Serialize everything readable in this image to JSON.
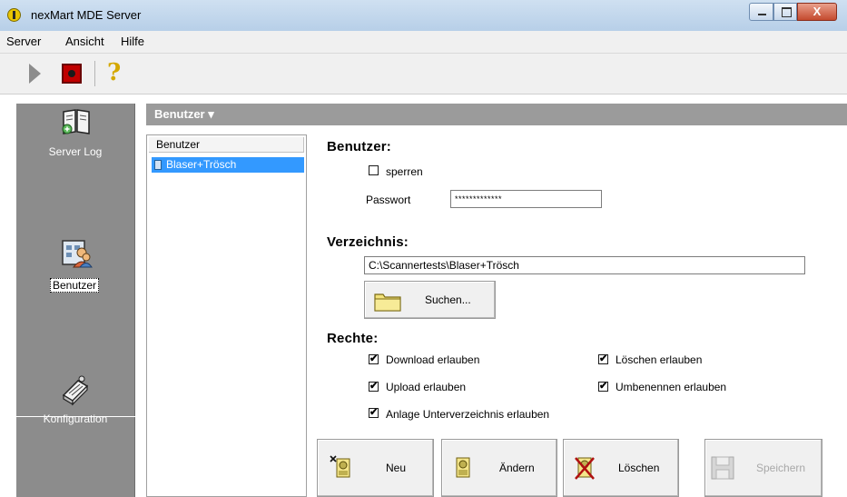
{
  "window": {
    "title": "nexMart MDE Server",
    "close_glyph": "X"
  },
  "menu": [
    "Server",
    "Ansicht",
    "Hilfe"
  ],
  "toolbar": {
    "icons": [
      "play-icon",
      "stop-icon",
      "help-icon"
    ],
    "help_glyph": "?"
  },
  "nav": {
    "items": [
      {
        "label": "Server Log",
        "icon": "book-icon"
      },
      {
        "label": "Benutzer",
        "icon": "users-icon",
        "selected": true
      },
      {
        "label": "Konfiguration",
        "icon": "config-icon"
      }
    ]
  },
  "section": {
    "title": "Benutzer ▾"
  },
  "list": {
    "header": "Benutzer",
    "items": [
      "Blaser+Trösch"
    ]
  },
  "form": {
    "benutzer_heading": "Benutzer:",
    "sperren_label": "sperren",
    "sperren_checked": false,
    "passwort_label": "Passwort",
    "passwort_value": "*************",
    "verzeichnis_heading": "Verzeichnis:",
    "verzeichnis_value": "C:\\Scannertests\\Blaser+Trösch",
    "suchen_label": "Suchen...",
    "rechte_heading": "Rechte:",
    "rights": [
      {
        "label": "Download erlauben",
        "checked": true
      },
      {
        "label": "Löschen erlauben",
        "checked": true
      },
      {
        "label": "Upload erlauben",
        "checked": true
      },
      {
        "label": "Umbenennen erlauben",
        "checked": true
      },
      {
        "label": "Anlage Unterverzeichnis erlauben",
        "checked": true
      }
    ],
    "check_glyph": "✔"
  },
  "actions": {
    "neu": "Neu",
    "aendern": "Ändern",
    "loeschen": "Löschen",
    "speichern": "Speichern"
  }
}
